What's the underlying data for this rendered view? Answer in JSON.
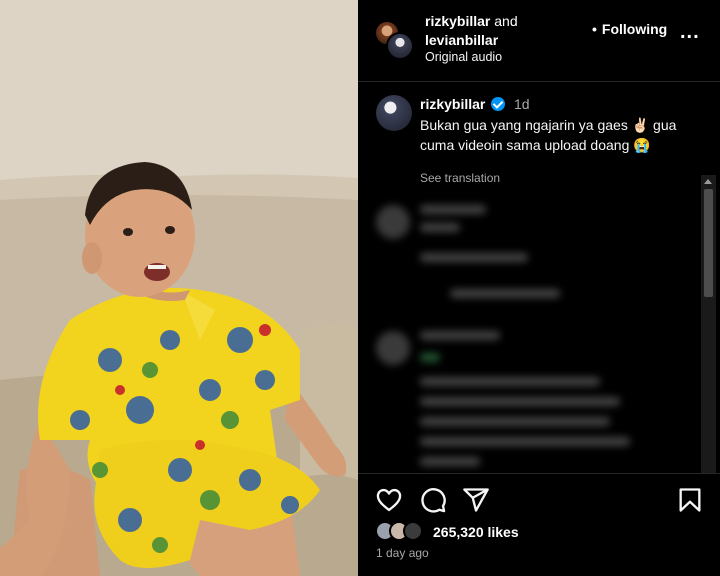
{
  "header": {
    "user1": "rizkybillar",
    "conjunction": "and",
    "user2": "levianbillar",
    "audio": "Original audio",
    "follow_status": "Following",
    "more_label": "..."
  },
  "caption": {
    "username": "rizkybillar",
    "time": "1d",
    "text": "Bukan gua yang ngajarin ya gaes ✌🏻 gua cuma videoin sama upload doang 😭",
    "see_translation": "See translation"
  },
  "actions": {
    "like_icon": "heart-icon",
    "comment_icon": "comment-icon",
    "share_icon": "share-icon",
    "save_icon": "bookmark-icon",
    "likes": "265,320 likes",
    "posted": "1 day ago"
  },
  "colors": {
    "background": "#000000",
    "verified": "#0095f6",
    "muted_text": "#a8a8a8",
    "shirt": "#f3d31f"
  }
}
